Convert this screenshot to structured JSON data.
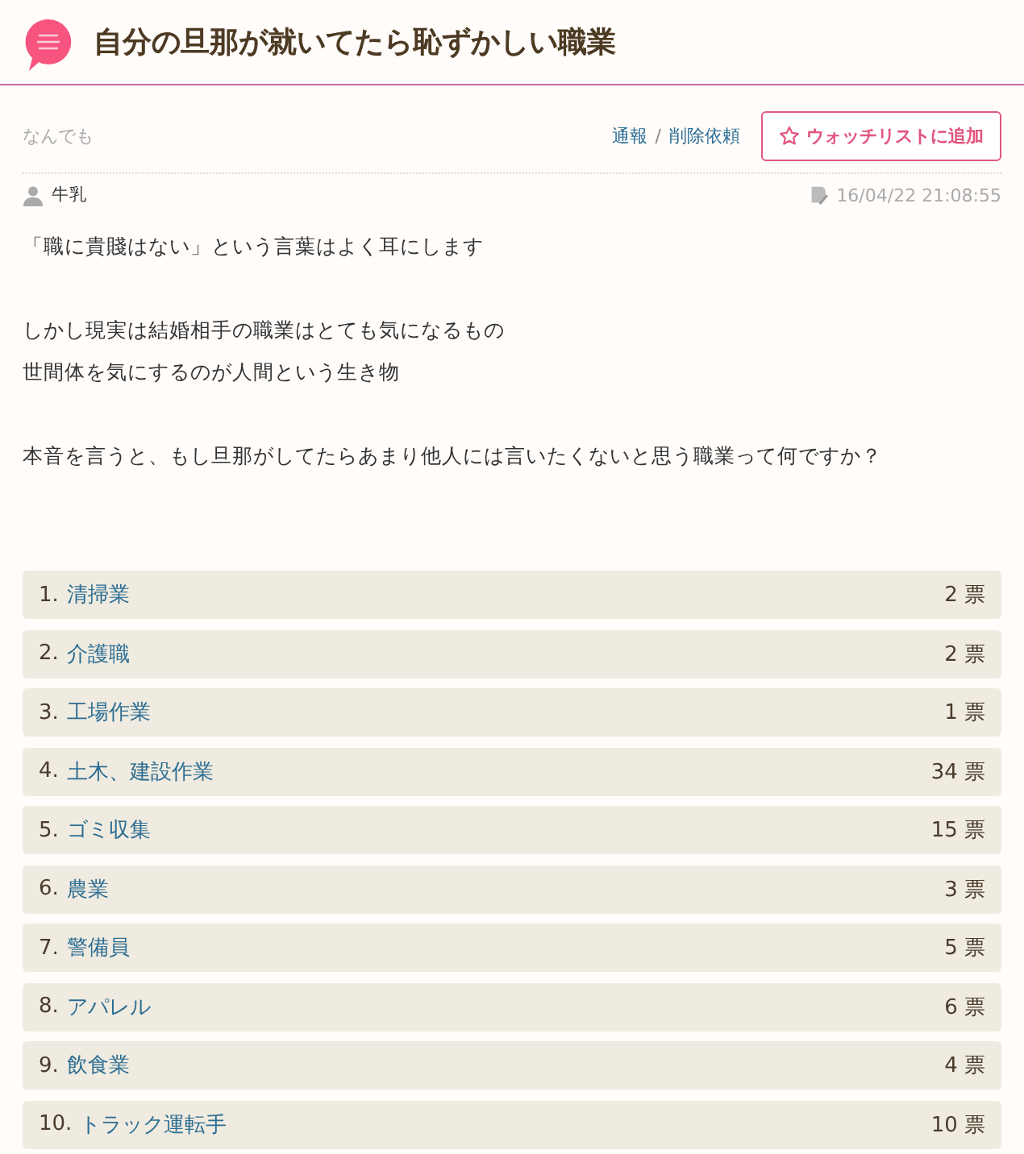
{
  "title": "自分の旦那が就いてたら恥ずかしい職業",
  "category": "なんでも",
  "report_link": "通報",
  "separator": "/",
  "delete_link": "削除依頼",
  "watch_button": "ウォッチリストに追加",
  "author": "牛乳",
  "timestamp": "16/04/22 21:08:55",
  "paragraphs": [
    [
      "「職に貴賤はない」という言葉はよく耳にします"
    ],
    [
      "しかし現実は結婚相手の職業はとても気になるもの",
      "世間体を気にするのが人間という生き物"
    ],
    [
      "本音を言うと、もし旦那がしてたらあまり他人には言いたくないと思う職業って何ですか？"
    ]
  ],
  "options": [
    {
      "number": "1.",
      "label": "清掃業",
      "votes": "2 票"
    },
    {
      "number": "2.",
      "label": "介護職",
      "votes": "2 票"
    },
    {
      "number": "3.",
      "label": "工場作業",
      "votes": "1 票"
    },
    {
      "number": "4.",
      "label": "土木、建設作業",
      "votes": "34 票"
    },
    {
      "number": "5.",
      "label": "ゴミ収集",
      "votes": "15 票"
    },
    {
      "number": "6.",
      "label": "農業",
      "votes": "3 票"
    },
    {
      "number": "7.",
      "label": "警備員",
      "votes": "5 票"
    },
    {
      "number": "8.",
      "label": "アパレル",
      "votes": "6 票"
    },
    {
      "number": "9.",
      "label": "飲食業",
      "votes": "4 票"
    },
    {
      "number": "10.",
      "label": "トラック運転手",
      "votes": "10 票"
    }
  ]
}
